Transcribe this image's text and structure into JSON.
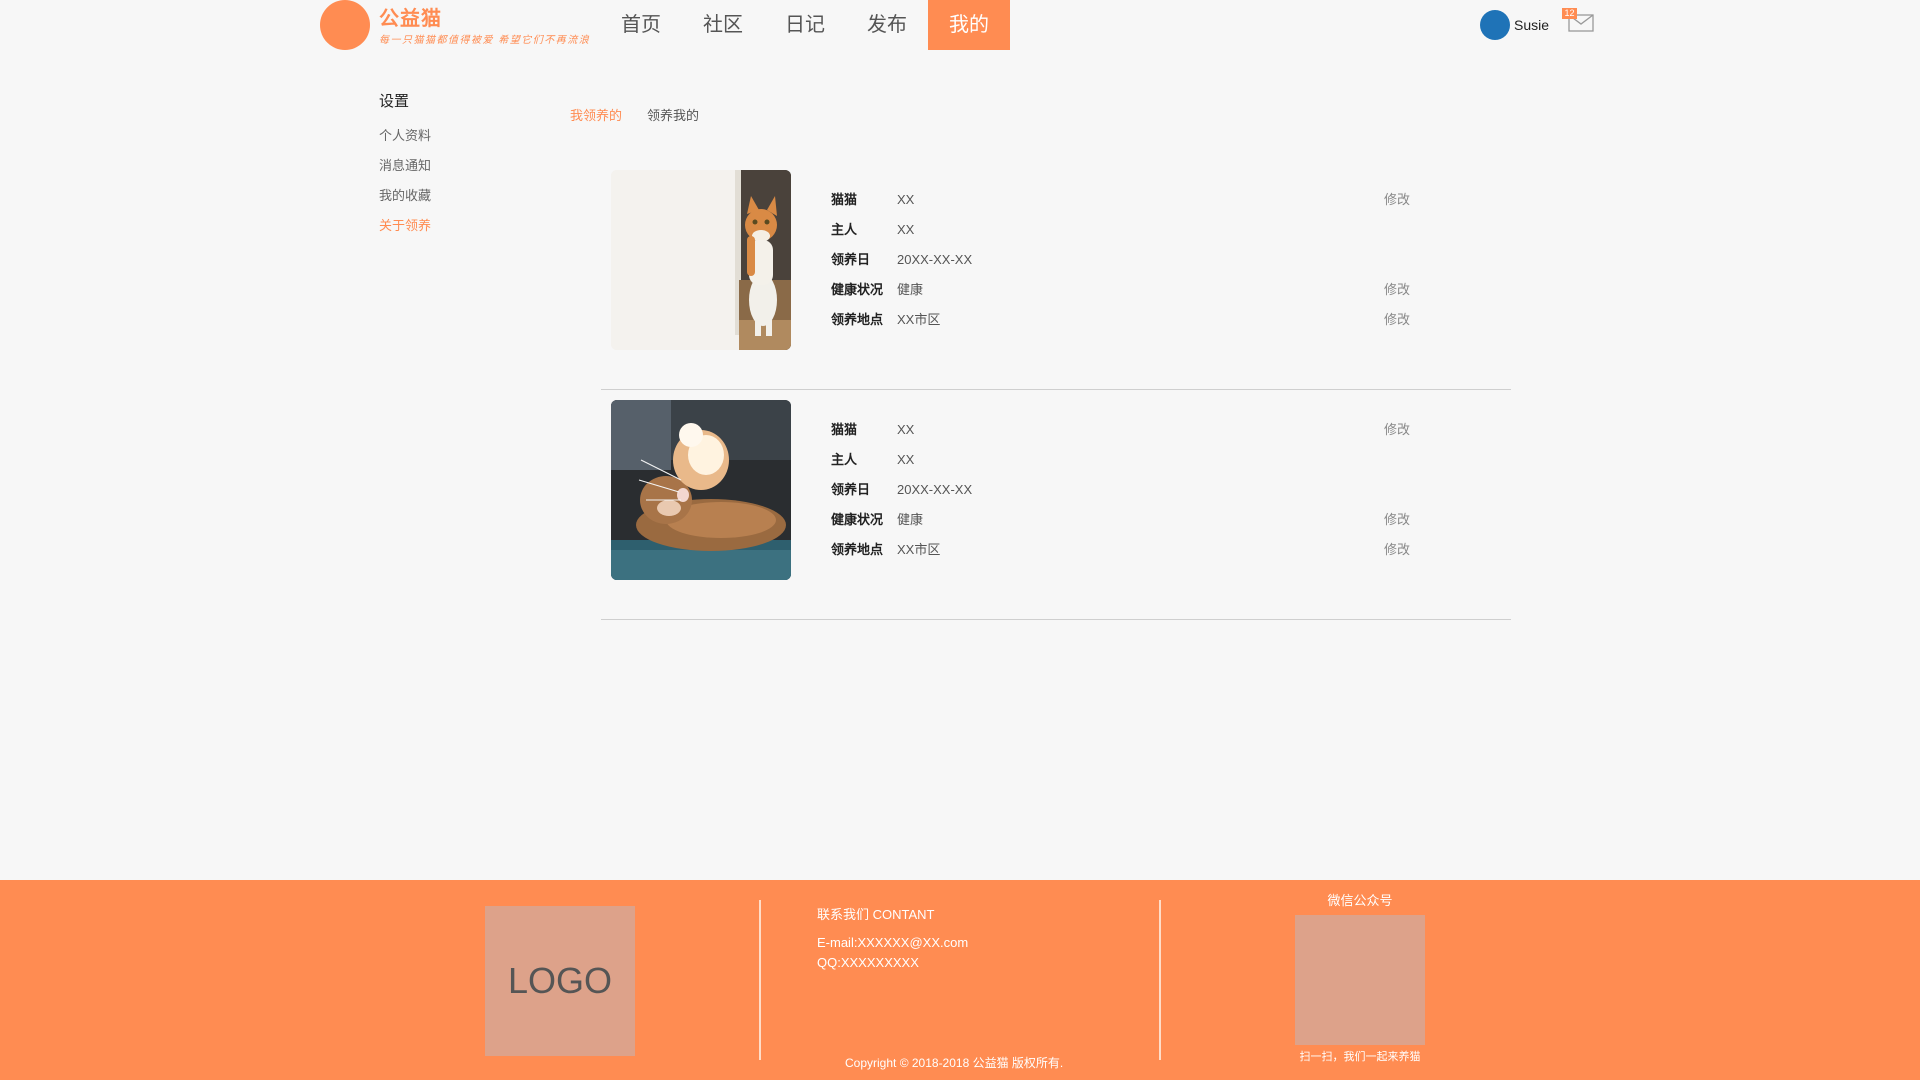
{
  "brand": {
    "name": "公益猫",
    "slogan": "每一只猫猫都值得被爱 希望它们不再流浪"
  },
  "nav": {
    "items": [
      {
        "label": "首页"
      },
      {
        "label": "社区"
      },
      {
        "label": "日记"
      },
      {
        "label": "发布"
      },
      {
        "label": "我的"
      }
    ],
    "active": "我的"
  },
  "user": {
    "name": "Susie",
    "mail_badge": "12"
  },
  "sidebar": {
    "title": "设置",
    "items": [
      {
        "label": "个人资料"
      },
      {
        "label": "消息通知"
      },
      {
        "label": "我的收藏"
      },
      {
        "label": "关于领养"
      }
    ],
    "active": "关于领养"
  },
  "tabs": [
    {
      "label": "我领养的"
    },
    {
      "label": "领养我的"
    }
  ],
  "cards": [
    {
      "rows": [
        {
          "label": "猫猫",
          "value": "XX",
          "edit": "修改"
        },
        {
          "label": "主人",
          "value": "XX",
          "edit": ""
        },
        {
          "label": "领养日",
          "value": "20XX-XX-XX",
          "edit": ""
        },
        {
          "label": "健康状况",
          "value": "健康",
          "edit": "修改"
        },
        {
          "label": "领养地点",
          "value": "XX市区",
          "edit": "修改"
        }
      ]
    },
    {
      "rows": [
        {
          "label": "猫猫",
          "value": "XX",
          "edit": "修改"
        },
        {
          "label": "主人",
          "value": "XX",
          "edit": ""
        },
        {
          "label": "领养日",
          "value": "20XX-XX-XX",
          "edit": ""
        },
        {
          "label": "健康状况",
          "value": "健康",
          "edit": "修改"
        },
        {
          "label": "领养地点",
          "value": "XX市区",
          "edit": "修改"
        }
      ]
    }
  ],
  "footer": {
    "logo": "LOGO",
    "contact_title": "联系我们 CONTANT",
    "email": "E-mail:XXXXXX@XX.com",
    "qq": "QQ:XXXXXXXXX",
    "copyright": "Copyright © 2018-2018 公益猫 版权所有.",
    "wechat_title": "微信公众号",
    "qr_caption": "扫一扫，我们一起来养猫"
  },
  "colors": {
    "accent": "#ff8c52",
    "avatar": "#1f73b7",
    "placeholder": "#dda28a"
  }
}
